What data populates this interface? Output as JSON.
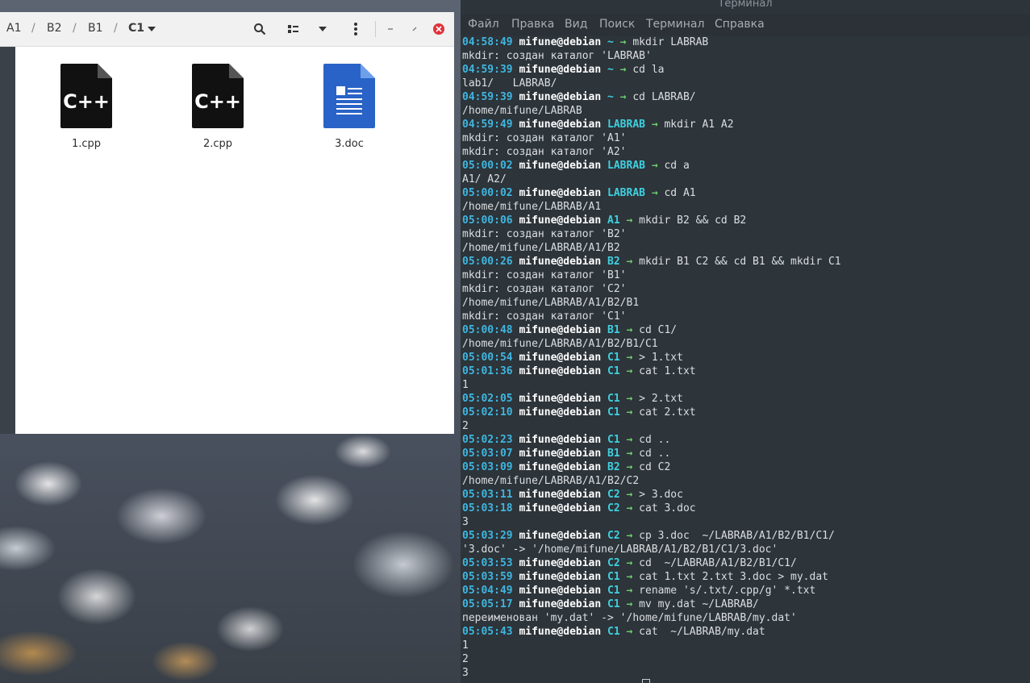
{
  "file_manager": {
    "breadcrumbs": [
      "A1",
      "B2",
      "B1",
      "C1"
    ],
    "files": [
      {
        "name": "1.cpp",
        "icon": "cpp-file-icon"
      },
      {
        "name": "2.cpp",
        "icon": "cpp-file-icon"
      },
      {
        "name": "3.doc",
        "icon": "doc-file-icon"
      }
    ],
    "cpp_icon_text": "C++"
  },
  "terminal": {
    "title": "Терминал",
    "menu": [
      "Файл",
      "Правка",
      "Вид",
      "Поиск",
      "Терминал",
      "Справка"
    ],
    "user": "mifune@debian",
    "lines": [
      {
        "t": "04:58:49",
        "d": "~",
        "cmd": "mkdir LABRAB"
      },
      {
        "o": "mkdir: создан каталог 'LABRAB'"
      },
      {
        "t": "04:59:39",
        "d": "~",
        "cmd": "cd la"
      },
      {
        "o": "lab1/   LABRAB/"
      },
      {
        "t": "04:59:39",
        "d": "~",
        "cmd": "cd LABRAB/"
      },
      {
        "o": "/home/mifune/LABRAB"
      },
      {
        "t": "04:59:49",
        "d": "LABRAB",
        "cmd": "mkdir A1 A2"
      },
      {
        "o": "mkdir: создан каталог 'A1'"
      },
      {
        "o": "mkdir: создан каталог 'A2'"
      },
      {
        "t": "05:00:02",
        "d": "LABRAB",
        "cmd": "cd a"
      },
      {
        "o": "A1/ A2/"
      },
      {
        "t": "05:00:02",
        "d": "LABRAB",
        "cmd": "cd A1"
      },
      {
        "o": "/home/mifune/LABRAB/A1"
      },
      {
        "t": "05:00:06",
        "d": "A1",
        "cmd": "mkdir B2 && cd B2"
      },
      {
        "o": "mkdir: создан каталог 'B2'"
      },
      {
        "o": "/home/mifune/LABRAB/A1/B2"
      },
      {
        "t": "05:00:26",
        "d": "B2",
        "cmd": "mkdir B1 C2 && cd B1 && mkdir C1"
      },
      {
        "o": "mkdir: создан каталог 'B1'"
      },
      {
        "o": "mkdir: создан каталог 'C2'"
      },
      {
        "o": "/home/mifune/LABRAB/A1/B2/B1"
      },
      {
        "o": "mkdir: создан каталог 'C1'"
      },
      {
        "t": "05:00:48",
        "d": "B1",
        "cmd": "cd C1/"
      },
      {
        "o": "/home/mifune/LABRAB/A1/B2/B1/C1"
      },
      {
        "t": "05:00:54",
        "d": "C1",
        "cmd": "> 1.txt"
      },
      {
        "t": "05:01:36",
        "d": "C1",
        "cmd": "cat 1.txt"
      },
      {
        "o": "1"
      },
      {
        "t": "05:02:05",
        "d": "C1",
        "cmd": "> 2.txt"
      },
      {
        "t": "05:02:10",
        "d": "C1",
        "cmd": "cat 2.txt"
      },
      {
        "o": "2"
      },
      {
        "t": "05:02:23",
        "d": "C1",
        "cmd": "cd .."
      },
      {
        "t": "05:03:07",
        "d": "B1",
        "cmd": "cd .."
      },
      {
        "t": "05:03:09",
        "d": "B2",
        "cmd": "cd C2"
      },
      {
        "o": "/home/mifune/LABRAB/A1/B2/C2"
      },
      {
        "t": "05:03:11",
        "d": "C2",
        "cmd": "> 3.doc"
      },
      {
        "t": "05:03:18",
        "d": "C2",
        "cmd": "cat 3.doc"
      },
      {
        "o": "3"
      },
      {
        "t": "05:03:29",
        "d": "C2",
        "cmd": "cp 3.doc  ~/LABRAB/A1/B2/B1/C1/"
      },
      {
        "o": "'3.doc' -> '/home/mifune/LABRAB/A1/B2/B1/C1/3.doc'"
      },
      {
        "t": "05:03:53",
        "d": "C2",
        "cmd": "cd  ~/LABRAB/A1/B2/B1/C1/"
      },
      {
        "t": "05:03:59",
        "d": "C1",
        "cmd": "cat 1.txt 2.txt 3.doc > my.dat"
      },
      {
        "t": "05:04:49",
        "d": "C1",
        "cmd": "rename 's/.txt/.cpp/g' *.txt"
      },
      {
        "t": "05:05:17",
        "d": "C1",
        "cmd": "mv my.dat ~/LABRAB/"
      },
      {
        "o": "переименован 'my.dat' -> '/home/mifune/LABRAB/my.dat'"
      },
      {
        "t": "05:05:43",
        "d": "C1",
        "cmd": "cat  ~/LABRAB/my.dat"
      },
      {
        "o": "1"
      },
      {
        "o": "2"
      },
      {
        "o": "3"
      }
    ]
  },
  "colors": {
    "timestamp": "#3fb6e0",
    "directory": "#3fd0e0",
    "arrow": "#6fd06f",
    "terminal_bg": "#2d343a",
    "close_button": "#e0323c"
  }
}
